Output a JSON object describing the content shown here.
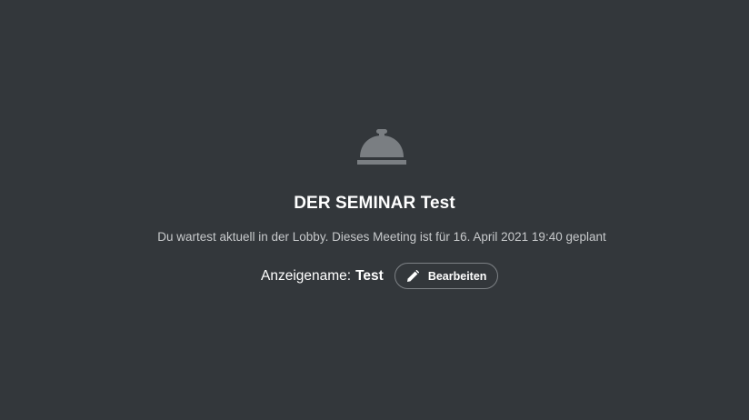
{
  "lobby": {
    "icon": "room-service-bell-icon",
    "title": "DER SEMINAR Test",
    "message": "Du wartest aktuell in der Lobby. Dieses Meeting ist für 16. April 2021 19:40 geplant",
    "display_name_label": "Anzeigename:",
    "display_name_value": "Test",
    "edit_button_label": "Bearbeiten",
    "edit_icon": "pencil-icon"
  },
  "colors": {
    "background": "#33373b",
    "icon": "#7a7e82",
    "text": "#ffffff",
    "muted_text": "#c7c9cb",
    "button_border": "#7d8185"
  }
}
